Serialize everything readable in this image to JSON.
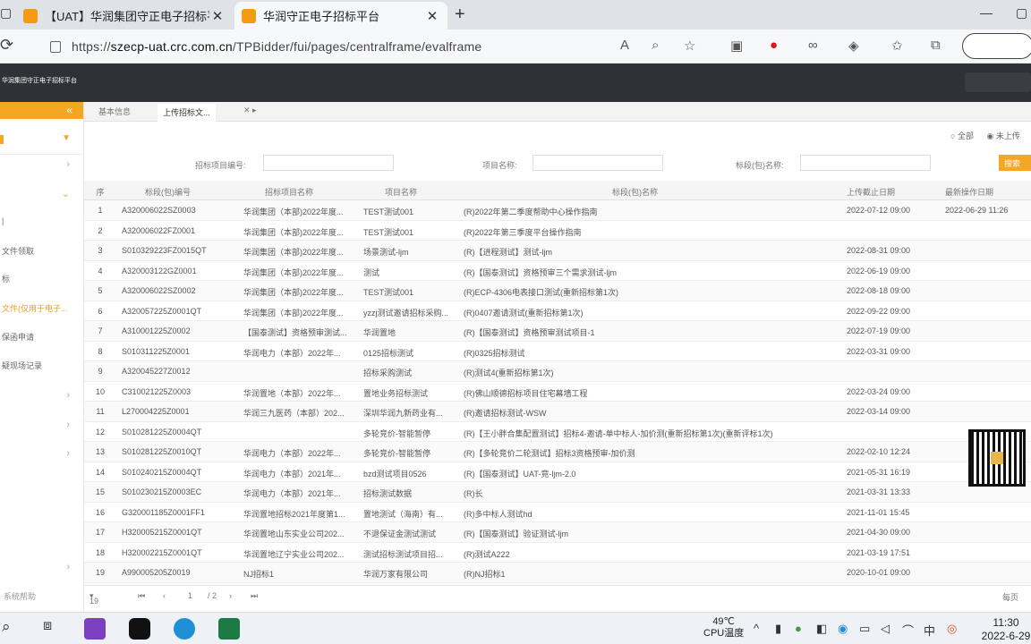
{
  "browser": {
    "tabs": [
      {
        "title": "【UAT】华润集团守正电子招标平"
      },
      {
        "title": "华润守正电子招标平台"
      }
    ],
    "new_tab": "+",
    "url_prefix": "https://",
    "url_host": "szecp-uat.crc.com.cn",
    "url_path": "/TPBidder/fui/pages/centralframe/evalframe",
    "min": "—",
    "restore": "▢"
  },
  "app": {
    "logo": "华润集团守正电子招标平台"
  },
  "sidebar": {
    "items": [
      {
        "label": ""
      },
      {
        "label": ""
      },
      {
        "label": "文件领取"
      },
      {
        "label": "标"
      },
      {
        "label": "文件(仅用于电子..."
      },
      {
        "label": "保函申请"
      },
      {
        "label": "疑现场记录"
      }
    ],
    "footer": "系统帮助"
  },
  "tabs": [
    {
      "label": "基本信息"
    },
    {
      "label": "上传招标文..."
    }
  ],
  "radios": [
    {
      "label": "全部"
    },
    {
      "label": "未上传"
    }
  ],
  "filters": {
    "f1": "招标项目编号:",
    "f2": "项目名称:",
    "f3": "标段(包)名称:",
    "search": "搜索"
  },
  "grid": {
    "headers": [
      "序",
      "标段(包)编号",
      "招标项目名称",
      "项目名称",
      "标段(包)名称",
      "上传截止日期",
      "最新操作日期"
    ],
    "rows": [
      {
        "n": "1",
        "code": "A320006022SZ0003",
        "proj": "华润集团（本部)2022年度...",
        "name": "TEST测试001",
        "pkg": "(R)2022年第二季度帮助中心操作指南",
        "deadline": "2022-07-12 09:00",
        "op": "2022-06-29 11:26"
      },
      {
        "n": "2",
        "code": "A320006022FZ0001",
        "proj": "华润集团（本部)2022年度...",
        "name": "TEST测试001",
        "pkg": "(R)2022年第三季度平台操作指南",
        "deadline": "",
        "op": ""
      },
      {
        "n": "3",
        "code": "S010329223FZ0015QT",
        "proj": "华润集团（本部)2022年度...",
        "name": "场景测试-ljm",
        "pkg": "(R)【进程测试】测试-ljm",
        "deadline": "2022-08-31 09:00",
        "op": ""
      },
      {
        "n": "4",
        "code": "A320003122GZ0001",
        "proj": "华润集团（本部)2022年度...",
        "name": "测试",
        "pkg": "(R)【国泰测试】资格预审三个需求测试-ljm",
        "deadline": "2022-06-19 09:00",
        "op": ""
      },
      {
        "n": "5",
        "code": "A320006022SZ0002",
        "proj": "华润集团（本部)2022年度...",
        "name": "TEST测试001",
        "pkg": "(R)ECP-4306电表接口测试(重新招标第1次)",
        "deadline": "2022-08-18 09:00",
        "op": ""
      },
      {
        "n": "6",
        "code": "A320057225Z0001QT",
        "proj": "华润集团（本部)2022年度...",
        "name": "yzzj测试邀请招标采购...",
        "pkg": "(R)0407邀请测试(重新招标第1次)",
        "deadline": "2022-09-22 09:00",
        "op": ""
      },
      {
        "n": "7",
        "code": "A310001225Z0002",
        "proj": "【国泰测试】资格预审测试...",
        "name": "华润置地",
        "pkg": "(R)【国泰测试】资格预审测试项目-1",
        "deadline": "2022-07-19 09:00",
        "op": ""
      },
      {
        "n": "8",
        "code": "S010311225Z0001",
        "proj": "华润电力（本部）2022年...",
        "name": "0125招标测试",
        "pkg": "(R)0325招标测试",
        "deadline": "2022-03-31 09:00",
        "op": ""
      },
      {
        "n": "9",
        "code": "A320045227Z0012",
        "proj": "",
        "name": "招标采购测试",
        "pkg": "(R)测试4(重新招标第1次)",
        "deadline": "",
        "op": ""
      },
      {
        "n": "10",
        "code": "C310021225Z0003",
        "proj": "华润置地（本部）2022年...",
        "name": "置地业务招标测试",
        "pkg": "(R)佛山顺德招标项目住宅幕墙工程",
        "deadline": "2022-03-24 09:00",
        "op": ""
      },
      {
        "n": "11",
        "code": "L270004225Z0001",
        "proj": "华润三九医药（本部）202...",
        "name": "深圳华润九新药业有...",
        "pkg": "(R)邀请招标测试-WSW",
        "deadline": "2022-03-14 09:00",
        "op": ""
      },
      {
        "n": "12",
        "code": "S010281225Z0004QT",
        "proj": "",
        "name": "多轮竞价-智能暂停",
        "pkg": "(R)【王小胖合集配置测试】招标4-邀请-单中标人-加价测(重新招标第1次)(重新评标1次)",
        "deadline": "",
        "op": ""
      },
      {
        "n": "13",
        "code": "S010281225Z0010QT",
        "proj": "华润电力（本部）2022年...",
        "name": "多轮竞价-智能暂停",
        "pkg": "(R)【多轮竞价二轮测试】招标3资格预审-加价测",
        "deadline": "2022-02-10 12:24",
        "op": ""
      },
      {
        "n": "14",
        "code": "S010240215Z0004QT",
        "proj": "华润电力（本部）2021年...",
        "name": "bzd测试项目0526",
        "pkg": "(R)【国泰测试】UAT-竞-ljm-2.0",
        "deadline": "2021-05-31 16:19",
        "op": ""
      },
      {
        "n": "15",
        "code": "S010230215Z0003EC",
        "proj": "华润电力（本部）2021年...",
        "name": "招标测试数据",
        "pkg": "(R)长",
        "deadline": "2021-03-31 13:33",
        "op": ""
      },
      {
        "n": "16",
        "code": "G320001185Z0001FF1",
        "proj": "华润置地招标2021年度第1...",
        "name": "置地测试（海南）有...",
        "pkg": "(R)多中标人测试hd",
        "deadline": "2021-11-01 15:45",
        "op": ""
      },
      {
        "n": "17",
        "code": "H320005215Z0001QT",
        "proj": "华润置地山东实业公司202...",
        "name": "不退保证金测试测试",
        "pkg": "(R)【国泰测试】验证测试-ljm",
        "deadline": "2021-04-30 09:00",
        "op": ""
      },
      {
        "n": "18",
        "code": "H320002215Z0001QT",
        "proj": "华润置地辽宁实业公司202...",
        "name": "测试招标测试项目招...",
        "pkg": "(R)测试A222",
        "deadline": "2021-03-19 17:51",
        "op": ""
      },
      {
        "n": "19",
        "code": "A990005205Z0019",
        "proj": "NJ招标1",
        "name": "华润万家有限公司",
        "pkg": "(R)NJ招标1",
        "deadline": "2020-10-01 09:00",
        "op": ""
      }
    ]
  },
  "pager": {
    "size": "19",
    "cur": "1",
    "total": "/ 2",
    "info": "每页"
  },
  "taskbar": {
    "temp": "49℃",
    "cpu": "CPU温度",
    "time": "11:30",
    "date": "2022-6-29"
  }
}
